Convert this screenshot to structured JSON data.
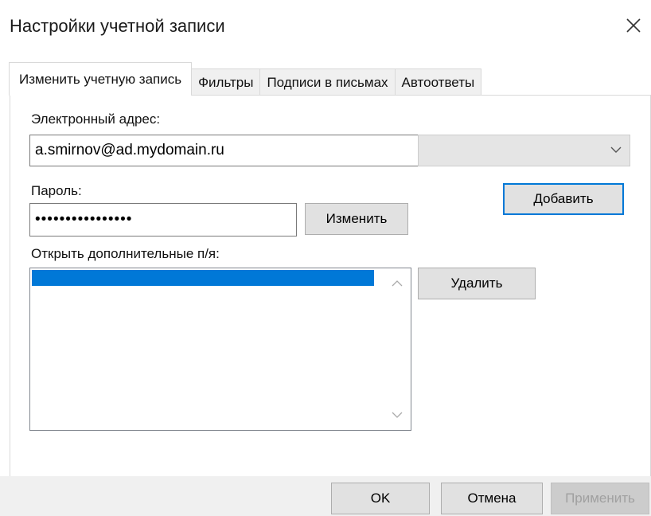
{
  "window": {
    "title": "Настройки учетной записи"
  },
  "tabs": [
    {
      "label": "Изменить учетную запись",
      "active": true
    },
    {
      "label": "Фильтры",
      "active": false
    },
    {
      "label": "Подписи в письмах",
      "active": false
    },
    {
      "label": "Автоответы",
      "active": false
    }
  ],
  "email": {
    "label": "Электронный адрес:",
    "value": "a.smirnov@ad.mydomain.ru"
  },
  "combo": {
    "value": "",
    "icon": "chevron-down-icon"
  },
  "add_button": "Добавить",
  "password": {
    "label": "Пароль:",
    "value": "••••••••••••••••"
  },
  "change_button": "Изменить",
  "mailboxes": {
    "label": "Открыть дополнительные п/я:"
  },
  "delete_button": "Удалить",
  "footer": {
    "ok": "OK",
    "cancel": "Отмена",
    "apply": "Применить"
  },
  "colors": {
    "accent": "#0078d7",
    "button_bg": "#e1e1e1",
    "footer_bg": "#f0f0f0"
  }
}
